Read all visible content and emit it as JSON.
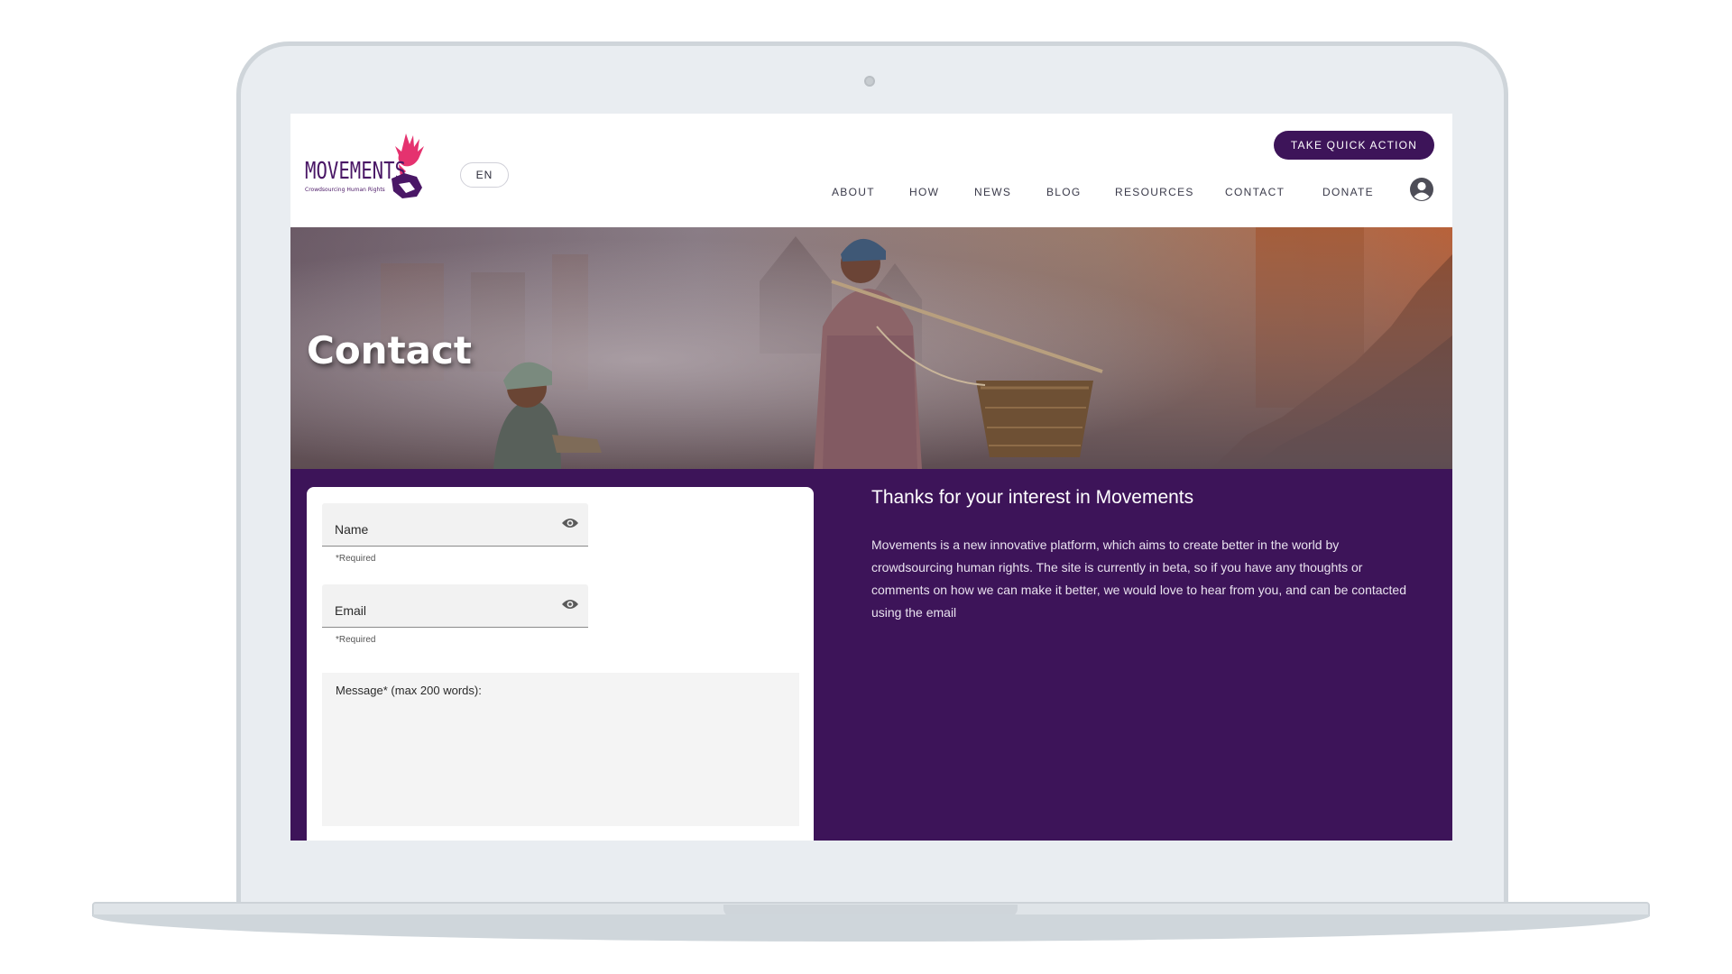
{
  "header": {
    "language": "EN",
    "cta_label": "TAKE QUICK ACTION",
    "logo_text": "MOVEMENTS",
    "logo_tagline": "Crowdsourcing Human Rights",
    "nav": [
      "ABOUT",
      "HOW",
      "NEWS",
      "BLOG",
      "RESOURCES",
      "CONTACT",
      "DONATE"
    ]
  },
  "hero": {
    "title": "Contact"
  },
  "form": {
    "name_label": "Name",
    "name_helper": "*Required",
    "email_label": "Email",
    "email_helper": "*Required",
    "message_label": "Message* (max 200 words):"
  },
  "info": {
    "heading": "Thanks for your interest in Movements",
    "body": "Movements is a new innovative platform, which aims to create better in the world by crowdsourcing human rights. The site is currently in beta, so if you have any thoughts or comments on how we can make it better, we would love to hear from you, and can be contacted using the email"
  },
  "colors": {
    "brand_purple": "#3d1459",
    "accent_pink": "#e5326f"
  },
  "icons": [
    "hand-logo-icon",
    "user-icon",
    "eye-icon"
  ]
}
